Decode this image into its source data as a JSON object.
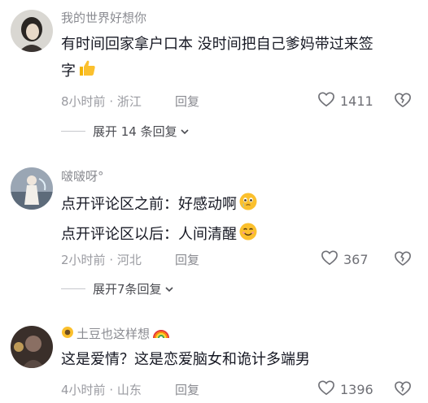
{
  "comments": [
    {
      "username": "我的世界好想你",
      "lines": [
        "有时间回家拿户口本 没时间把自己爹妈带过来签",
        "字"
      ],
      "time": "8小时前",
      "location": "浙江",
      "reply_label": "回复",
      "likes": "1411",
      "expand_label": "展开 14 条回复",
      "emoji": "thumbs-up-icon"
    },
    {
      "username": "啵啵呀°",
      "lines": [
        "点开评论区之前：好感动啊",
        "点开评论区以后：人间清醒"
      ],
      "time": "2小时前",
      "location": "河北",
      "reply_label": "回复",
      "likes": "367",
      "expand_label": "展开7条回复"
    },
    {
      "username": "土豆也这样想",
      "lines": [
        "这是爱情？这是恋爱脑女和诡计多端男"
      ],
      "time": "4小时前",
      "location": "山东",
      "reply_label": "回复",
      "likes": "1396"
    }
  ]
}
